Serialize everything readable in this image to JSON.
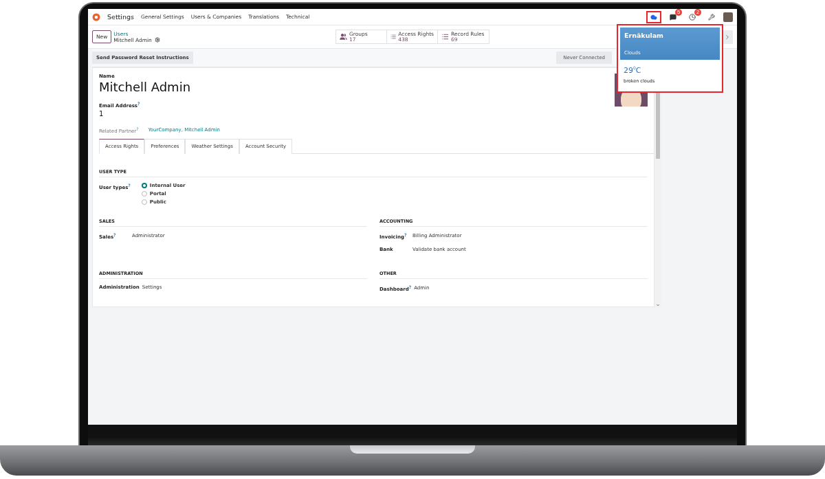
{
  "navbar": {
    "app": "Settings",
    "menus": [
      "General Settings",
      "Users & Companies",
      "Translations",
      "Technical"
    ],
    "indicators": [
      {
        "kind": "weather",
        "highlighted": true
      },
      {
        "kind": "chat",
        "count": "5",
        "highlighted": false
      },
      {
        "kind": "activity",
        "count": "2",
        "highlighted": false
      },
      {
        "kind": "tools",
        "highlighted": false
      }
    ]
  },
  "control_panel": {
    "new_button": "New",
    "breadcrumb": "Users",
    "record": "Mitchell Admin",
    "smart_buttons": [
      {
        "kind": "groups",
        "label": "Groups",
        "value": "17"
      },
      {
        "kind": "list",
        "label": "Access Rights",
        "value": "438"
      },
      {
        "kind": "list",
        "label": "Record Rules",
        "value": "69"
      }
    ]
  },
  "status_bar": {
    "action": "Send Password Reset Instructions",
    "stage": "Never Connected"
  },
  "form": {
    "name_label": "Name",
    "name": "Mitchell Admin",
    "email_label": "Email Address$^{?}$",
    "email": "1",
    "partner_label": "Related Partner$^{?}$",
    "partner": "YourCompany, Mitchell Admin",
    "tabs": [
      {
        "label": "Access Rights",
        "selected": true
      },
      {
        "label": "Preferences",
        "selected": false
      },
      {
        "label": "Weather Settings",
        "selected": false
      },
      {
        "label": "Account Security",
        "selected": false
      }
    ],
    "user_type": {
      "title": "USER TYPE",
      "label": "User types$^{?}$",
      "options": [
        {
          "label": "Internal User",
          "selected": true
        },
        {
          "label": "Portal",
          "selected": false
        },
        {
          "label": "Public",
          "selected": false
        }
      ]
    },
    "sections": [
      {
        "title": "SALES",
        "fields": [
          {
            "label": "Sales$^{?}$",
            "value": "Administrator"
          }
        ]
      },
      {
        "title": "ACCOUNTING",
        "fields": [
          {
            "label": "Invoicing$^{?}$",
            "value": "Billing Administrator"
          },
          {
            "label": "Bank",
            "value": "Validate bank account"
          }
        ]
      },
      {
        "title": "ADMINISTRATION",
        "fields": [
          {
            "label": "Administration",
            "value": "Settings"
          }
        ]
      },
      {
        "title": "OTHER",
        "fields": [
          {
            "label": "Dashboard$^{?}$",
            "value": "Admin"
          }
        ]
      }
    ]
  },
  "weather": {
    "city": "Ernākulam",
    "condition": "Clouds",
    "temperature": "29$^{0}$C",
    "description": "broken clouds"
  }
}
